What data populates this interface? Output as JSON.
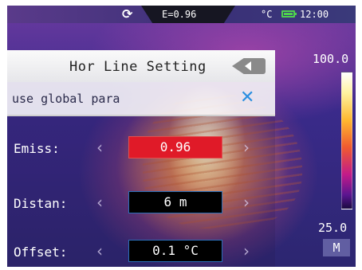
{
  "status_bar": {
    "refresh_icon": "refresh-icon",
    "emissivity": "E=0.96",
    "unit": "°C",
    "battery_icon": "battery-icon",
    "battery_color": "#4ed24e",
    "time": "12:00"
  },
  "menu": {
    "title": "Hor Line Setting",
    "back_icon": "back-arrow-icon",
    "global_label": "use global para",
    "global_toggle_icon": "close-icon",
    "rows": [
      {
        "label": "Emiss:",
        "value": "0.96",
        "selected": true
      },
      {
        "label": "Distan:",
        "value": "6 m",
        "selected": false
      },
      {
        "label": "Offset:",
        "value": "0.1 °C",
        "selected": false
      }
    ],
    "left_arrow": "‹",
    "right_arrow": "›"
  },
  "scale": {
    "max": "100.0",
    "min": "25.0",
    "mode": "M"
  },
  "colors": {
    "selected_value": "#e01a28",
    "toggle_accent": "#2a8ee0"
  }
}
